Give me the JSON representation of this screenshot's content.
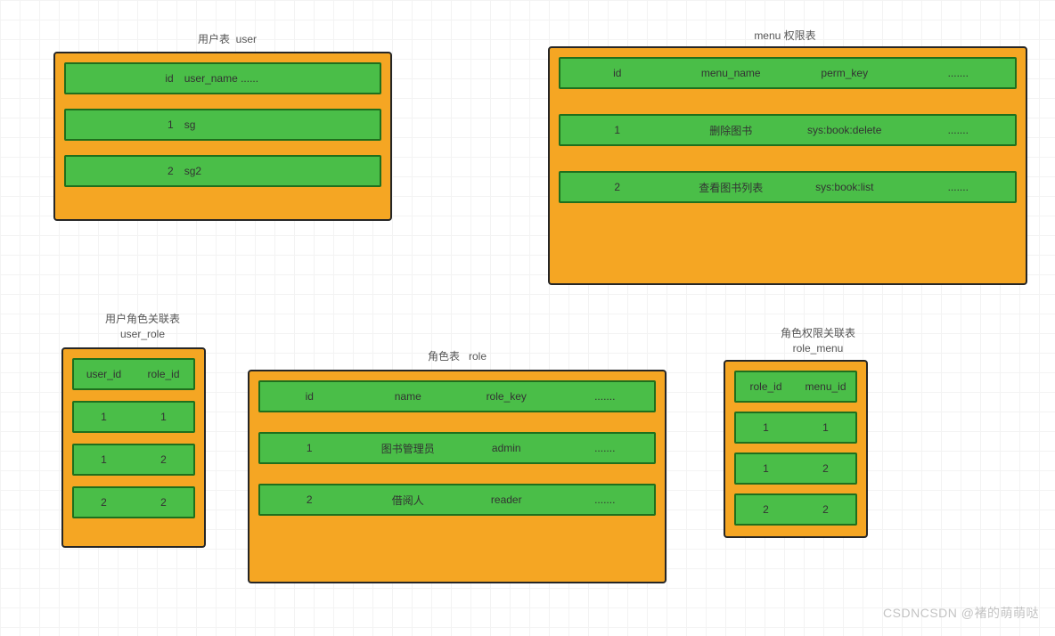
{
  "tables": {
    "user": {
      "title": "用户表  user",
      "rows": [
        [
          "id",
          "user_name ......"
        ],
        [
          "1",
          "sg"
        ],
        [
          "2",
          "sg2"
        ]
      ]
    },
    "menu": {
      "title": "menu 权限表",
      "rows": [
        [
          "id",
          "menu_name",
          "perm_key",
          "......."
        ],
        [
          "1",
          "删除图书",
          "sys:book:delete",
          "......."
        ],
        [
          "2",
          "查看图书列表",
          "sys:book:list",
          "......."
        ]
      ]
    },
    "user_role": {
      "title": "用户角色关联表\nuser_role",
      "rows": [
        [
          "user_id",
          "role_id"
        ],
        [
          "1",
          "1"
        ],
        [
          "1",
          "2"
        ],
        [
          "2",
          "2"
        ]
      ]
    },
    "role": {
      "title": "角色表   role",
      "rows": [
        [
          "id",
          "name",
          "role_key",
          "......."
        ],
        [
          "1",
          "图书管理员",
          "admin",
          "......."
        ],
        [
          "2",
          "借阅人",
          "reader",
          "......."
        ]
      ]
    },
    "role_menu": {
      "title": "角色权限关联表\nrole_menu",
      "rows": [
        [
          "role_id",
          "menu_id"
        ],
        [
          "1",
          "1"
        ],
        [
          "1",
          "2"
        ],
        [
          "2",
          "2"
        ]
      ]
    }
  },
  "watermark": "CSDNCSDN @褚的萌萌哒"
}
